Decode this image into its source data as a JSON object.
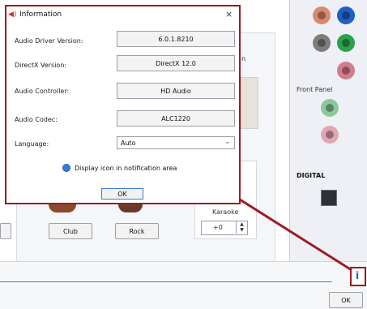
{
  "dialog": {
    "title": "Information",
    "fields": [
      {
        "label": "Audio Driver Version:",
        "value": "6.0.1.8210"
      },
      {
        "label": "DirectX Version:",
        "value": "DirectX 12.0"
      },
      {
        "label": "Audio Controller:",
        "value": "HD Audio"
      },
      {
        "label": "Audio Codec:",
        "value": "ALC1220"
      }
    ],
    "language_label": "Language:",
    "language_value": "Auto",
    "notify_label": "Display icon in notification area",
    "ok_label": "OK"
  },
  "background": {
    "front_panel_label": "Front Panel",
    "digital_label": "DIGITAL",
    "karaoke_label": "Karaoke",
    "karaoke_value": "+0",
    "club_label": "Club",
    "rock_label": "Rock",
    "partial_label": "n",
    "ok_label": "OK"
  },
  "colors": {
    "dialog_border": "#9b1c22",
    "jack_orange": "#d88a6a",
    "jack_blue": "#1f5fc4",
    "jack_gray": "#7d7d7d",
    "jack_green": "#2aa24a",
    "jack_pink": "#d47b8c",
    "front_green": "#8cc89a",
    "front_pink": "#e0a7b3"
  },
  "icons": {
    "speaker": "speaker-icon",
    "info": "info-icon",
    "close": "close-icon",
    "digital": "digital-port-icon"
  }
}
